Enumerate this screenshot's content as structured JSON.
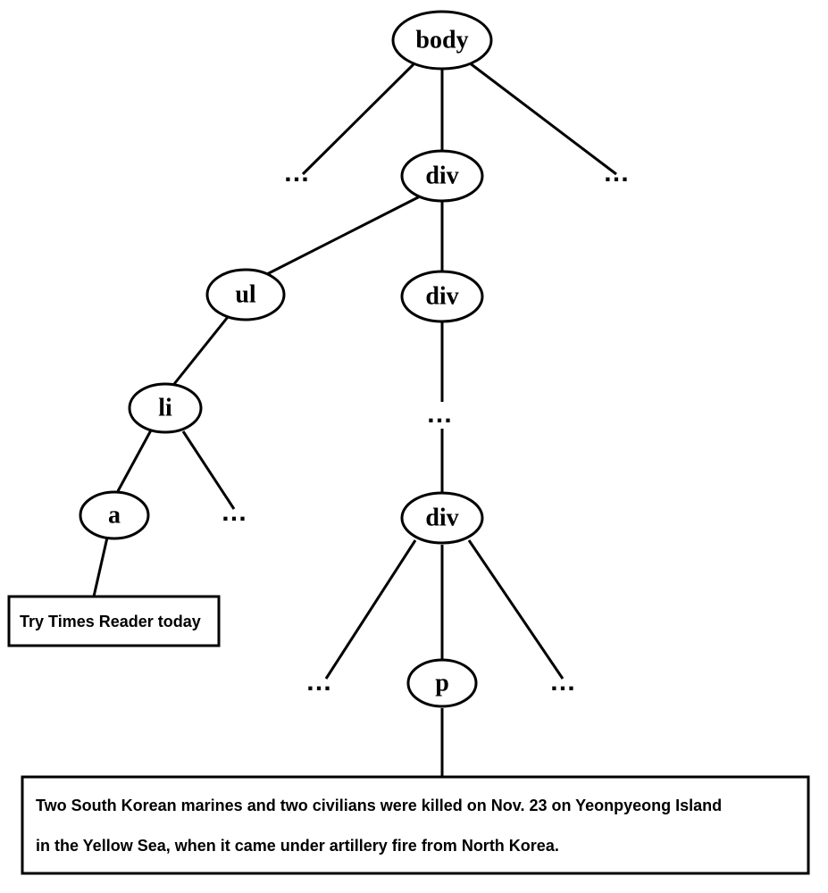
{
  "nodes": {
    "body": "body",
    "div1": "div",
    "ul": "ul",
    "div2": "div",
    "li": "li",
    "a": "a",
    "div3": "div",
    "p": "p"
  },
  "ellipsis": "…",
  "linkText": "Try Times Reader today",
  "paragraphLine1": "Two South Korean marines and two civilians were killed on Nov. 23 on Yeonpyeong Island",
  "paragraphLine2": "in the Yellow Sea, when it came under artillery fire from North Korea."
}
